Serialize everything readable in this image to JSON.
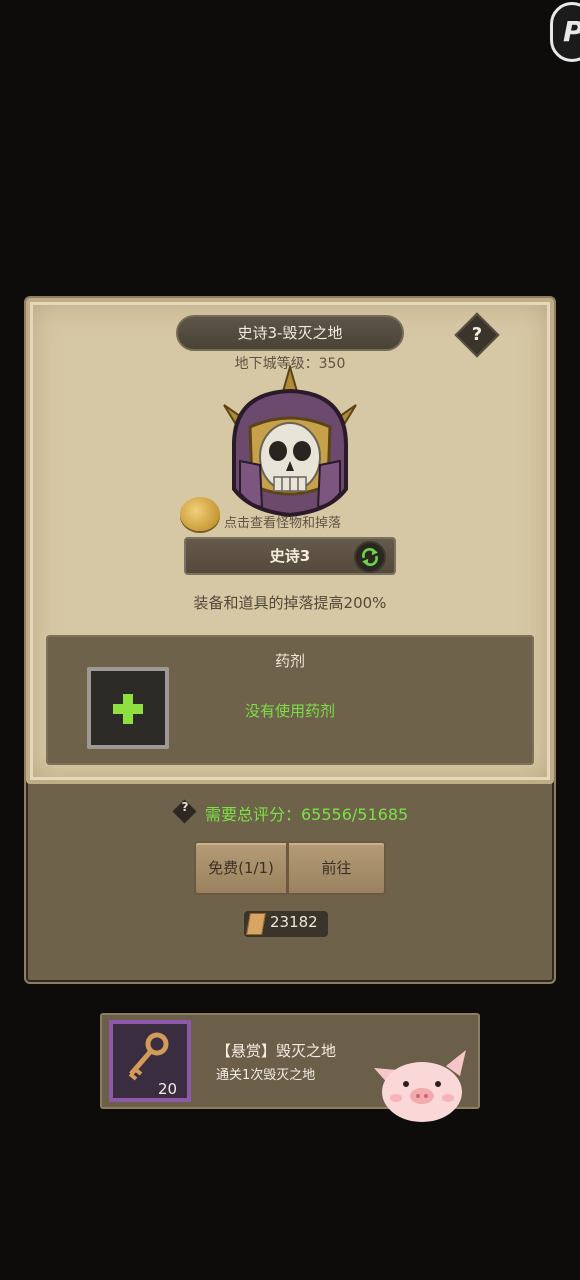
{
  "dungeon": {
    "title": "史诗3-毁灭之地",
    "level_text": "地下城等级：350",
    "boss_icon": "armored-skull-icon",
    "hint": "点击查看怪物和掉落",
    "difficulty": "史诗3",
    "drop_bonus": "装备和道具的掉落提高200%",
    "help": "?"
  },
  "potion": {
    "title": "药剂",
    "status": "没有使用药剂"
  },
  "score": {
    "text": "需要总评分：65556/51685",
    "help": "?"
  },
  "buttons": {
    "free": "免费(1/1)",
    "go": "前往"
  },
  "currency": {
    "ticket_count": "23182"
  },
  "quest": {
    "title": "【悬赏】毁灭之地",
    "desc": "通关1次毁灭之地",
    "count": "20",
    "icon": "key-icon"
  },
  "colors": {
    "green": "#7be246",
    "parchment": "#d7c8a5",
    "frame": "#6e624b"
  }
}
